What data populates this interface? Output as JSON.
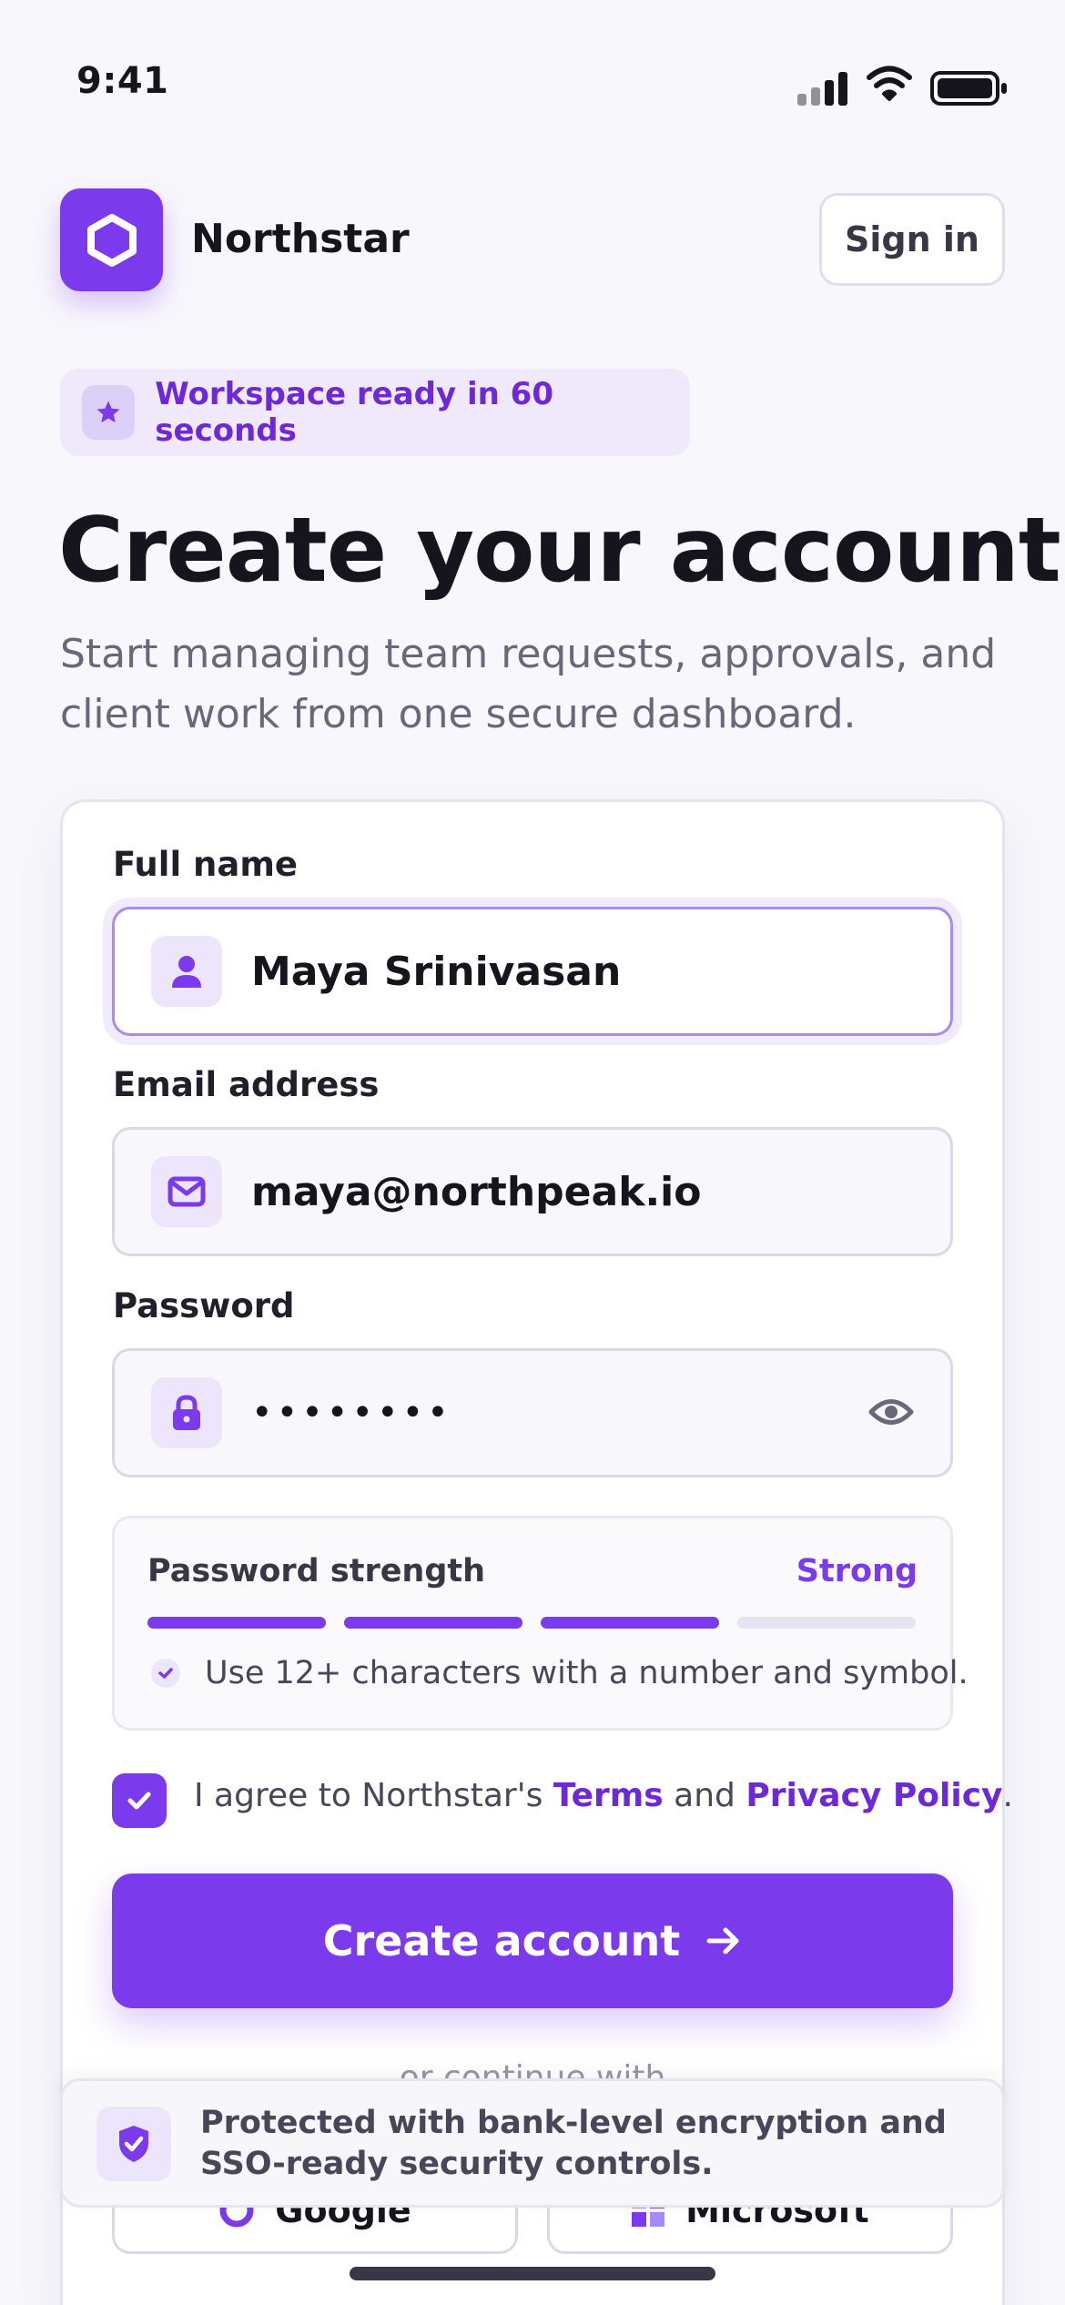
{
  "status_bar": {
    "time": "9:41"
  },
  "header": {
    "brand": "Northstar",
    "sign_in": "Sign in"
  },
  "badge": {
    "text": "Workspace ready in 60 seconds"
  },
  "hero": {
    "title": "Create your account",
    "subtitle": "Start managing team requests, approvals, and client work from one secure dashboard."
  },
  "form": {
    "full_name": {
      "label": "Full name",
      "value": "Maya Srinivasan"
    },
    "email": {
      "label": "Email address",
      "value": "maya@northpeak.io"
    },
    "password": {
      "label": "Password",
      "value": "••••••••"
    },
    "strength": {
      "label": "Password strength",
      "value": "Strong",
      "segments_filled": 3,
      "segments_total": 4,
      "hint": "Use 12+ characters with a number and symbol."
    },
    "agree": {
      "checked": true,
      "prefix": "I agree to Northstar's ",
      "terms": "Terms",
      "and": " and ",
      "privacy": "Privacy Policy",
      "suffix": "."
    },
    "submit": "Create account",
    "divider": "or continue with",
    "sso": {
      "google": "Google",
      "microsoft": "Microsoft"
    }
  },
  "security": {
    "text": "Protected with bank-level encryption and SSO-ready security controls."
  },
  "colors": {
    "accent": "#7c3aed",
    "accent_light": "#ece5fb",
    "background": "#f8f7fc"
  }
}
